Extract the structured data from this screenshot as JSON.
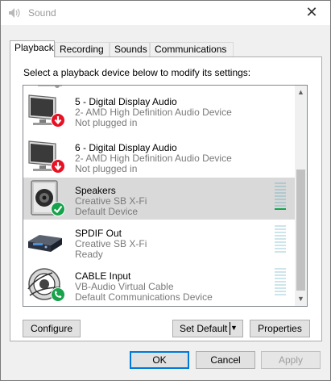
{
  "window": {
    "title": "Sound",
    "close_glyph": "✕"
  },
  "tabs": [
    {
      "label": "Playback",
      "active": true
    },
    {
      "label": "Recording",
      "active": false
    },
    {
      "label": "Sounds",
      "active": false
    },
    {
      "label": "Communications",
      "active": false
    }
  ],
  "instruction": "Select a playback device below to modify its settings:",
  "devices": [
    {
      "name": "5 - Digital Display Audio",
      "line2": "2- AMD High Definition Audio Device",
      "line3": "Not plugged in",
      "icon": "monitor-icon",
      "badge": "unplugged-badge-icon",
      "selected": false
    },
    {
      "name": "6 - Digital Display Audio",
      "line2": "2- AMD High Definition Audio Device",
      "line3": "Not plugged in",
      "icon": "monitor-icon",
      "badge": "unplugged-badge-icon",
      "selected": false
    },
    {
      "name": "Speakers",
      "line2": "Creative SB X-Fi",
      "line3": "Default Device",
      "icon": "speaker-icon",
      "badge": "default-check-icon",
      "selected": true
    },
    {
      "name": "SPDIF Out",
      "line2": "Creative SB X-Fi",
      "line3": "Ready",
      "icon": "spdif-box-icon",
      "badge": "",
      "selected": false
    },
    {
      "name": "CABLE Input",
      "line2": "VB-Audio Virtual Cable",
      "line3": "Default Communications Device",
      "icon": "cable-speaker-icon",
      "badge": "phone-badge-icon",
      "selected": false
    }
  ],
  "buttons": {
    "configure": "Configure",
    "set_default": "Set Default",
    "properties": "Properties",
    "ok": "OK",
    "cancel": "Cancel",
    "apply": "Apply"
  },
  "colors": {
    "selected_row": "#d9d9d9",
    "level_green": "#16a34a",
    "unplugged_red": "#e81123",
    "default_green": "#16a34a"
  }
}
